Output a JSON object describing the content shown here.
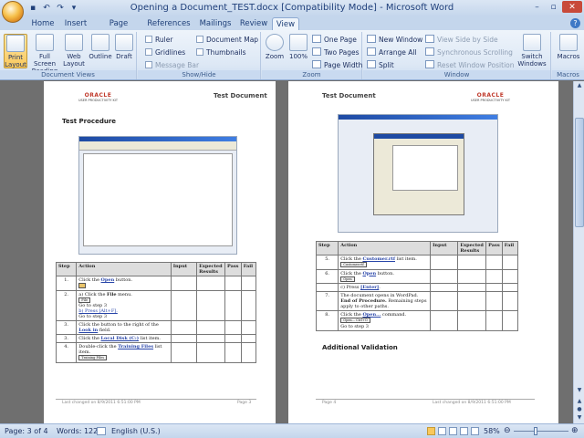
{
  "window": {
    "title": "Opening a Document_TEST.docx [Compatibility Mode] - Microsoft Word"
  },
  "tabs": [
    "Home",
    "Insert",
    "Page Layout",
    "References",
    "Mailings",
    "Review",
    "View"
  ],
  "active_tab": "View",
  "ribbon": {
    "document_views": {
      "label": "Document Views",
      "print_layout": "Print Layout",
      "full_screen_reading": "Full Screen Reading",
      "web_layout": "Web Layout",
      "outline": "Outline",
      "draft": "Draft"
    },
    "show_hide": {
      "label": "Show/Hide",
      "ruler": "Ruler",
      "gridlines": "Gridlines",
      "message_bar": "Message Bar",
      "document_map": "Document Map",
      "thumbnails": "Thumbnails"
    },
    "zoom": {
      "label": "Zoom",
      "zoom": "Zoom",
      "hundred": "100%",
      "one_page": "One Page",
      "two_pages": "Two Pages",
      "page_width": "Page Width"
    },
    "window": {
      "label": "Window",
      "new_window": "New Window",
      "arrange_all": "Arrange All",
      "split": "Split",
      "view_side_by_side": "View Side by Side",
      "sync_scrolling": "Synchronous Scrolling",
      "reset_window_position": "Reset Window Position",
      "switch_windows": "Switch Windows"
    },
    "macros": {
      "label": "Macros",
      "macros": "Macros"
    }
  },
  "page_left": {
    "logo": "ORACLE",
    "logo_sub": "USER PRODUCTIVITY KIT",
    "header_title": "Test Document",
    "heading": "Test Procedure",
    "table_headers": [
      "Step",
      "Action",
      "Input",
      "Expected Results",
      "Pass",
      "Fail"
    ],
    "rows": [
      {
        "step": "1.",
        "action_pre": "Click the ",
        "action_bold": "Open",
        "action_post": " button."
      },
      {
        "step": "2.",
        "action_pre": "a) Click the ",
        "action_bold": "File",
        "action_post": " menu.",
        "extra": "Go to step 3",
        "alt": "b) Press [Alt+F].",
        "alt2": "Go to step 3"
      },
      {
        "step": "3.",
        "action_pre": "Click the button to the right of the ",
        "action_bold": "Look in",
        "action_post": " field."
      },
      {
        "step": "3.",
        "action_pre": "Click the ",
        "action_bold": "Local Disk (C:)",
        "action_post": " list item."
      },
      {
        "step": "4.",
        "action_pre": "Double-click the ",
        "action_bold": "Training Files",
        "action_post": " list item.",
        "chip": "Training Files"
      }
    ],
    "footer_left": "Last changed on 8/9/2011  6:51:00  PM",
    "footer_right": "Page 3"
  },
  "page_right": {
    "logo": "ORACLE",
    "logo_sub": "USER PRODUCTIVITY KIT",
    "header_title": "Test Document",
    "table_headers": [
      "Step",
      "Action",
      "Input",
      "Expected Results",
      "Pass",
      "Fail"
    ],
    "rows": [
      {
        "step": "5.",
        "action_pre": "Click the ",
        "action_bold": "Customer.rtf",
        "action_post": " list item.",
        "chip": "Customer.rtf"
      },
      {
        "step": "6.",
        "action_pre": "Click the ",
        "action_bold": "Open",
        "action_post": " button.",
        "chip": "Open"
      },
      {
        "step": "",
        "action_pre": "c) Press ",
        "action_bold": "[Enter]",
        "action_post": "."
      },
      {
        "step": "7.",
        "action_pre": "The document opens in WordPad.",
        "action_bold": "End of Procedure.",
        "action_post": " Remaining steps apply to other paths."
      },
      {
        "step": "8.",
        "action_pre": "Click the ",
        "action_bold": "Open...",
        "action_post": " command.",
        "chip": "Open...    Ctrl+O",
        "extra": "Go to step 3"
      }
    ],
    "additional_heading": "Additional Validation",
    "footer_left": "Page 4",
    "footer_right": "Last changed on 8/9/2011  6:51:00  PM"
  },
  "status": {
    "page": "Page: 3 of 4",
    "words": "Words: 122",
    "language": "English (U.S.)",
    "zoom": "58%"
  },
  "colors": {
    "ribbon_bg": "#dde8f5",
    "title_text": "#1f3f7a",
    "oracle_red": "#c0392b"
  }
}
